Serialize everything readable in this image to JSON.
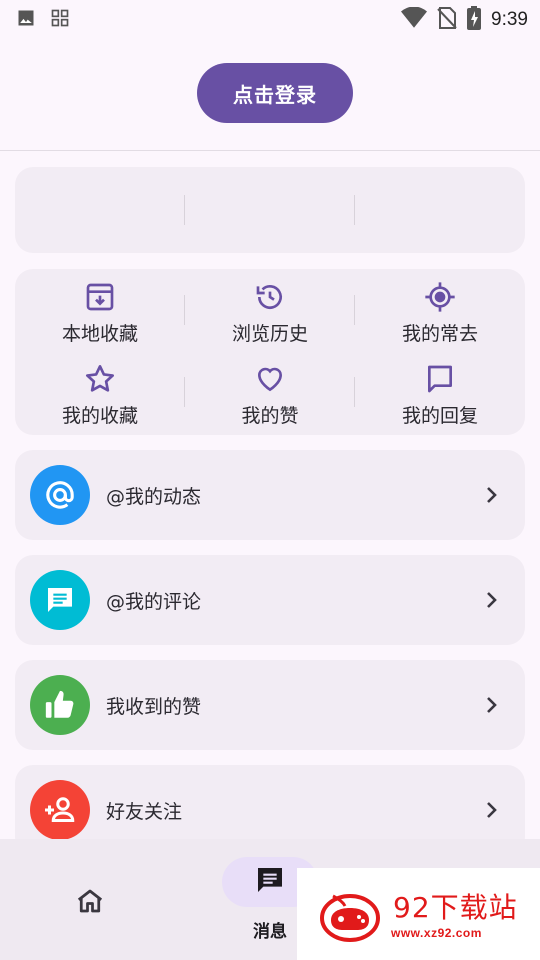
{
  "status_bar": {
    "time": "9:39",
    "left_icons": [
      "image-icon",
      "apps-icon"
    ],
    "right_icons": [
      "wifi-icon",
      "no-sim-icon",
      "battery-charging-icon"
    ]
  },
  "login": {
    "button_label": "点击登录"
  },
  "quick_grid": {
    "items": [
      {
        "label": "本地收藏",
        "icon": "archive-download-icon"
      },
      {
        "label": "浏览历史",
        "icon": "history-icon"
      },
      {
        "label": "我的常去",
        "icon": "location-target-icon"
      },
      {
        "label": "我的收藏",
        "icon": "star-icon"
      },
      {
        "label": "我的赞",
        "icon": "heart-icon"
      },
      {
        "label": "我的回复",
        "icon": "chat-bubble-icon"
      }
    ]
  },
  "message_rows": [
    {
      "label": "@我的动态",
      "icon": "at-icon",
      "color": "#2196f3"
    },
    {
      "label": "@我的评论",
      "icon": "comment-icon",
      "color": "#00bcd4"
    },
    {
      "label": "我收到的赞",
      "icon": "thumb-up-icon",
      "color": "#4caf50"
    },
    {
      "label": "好友关注",
      "icon": "person-add-icon",
      "color": "#f44336"
    }
  ],
  "bottom_nav": {
    "items": [
      {
        "label": "",
        "icon": "home-icon"
      },
      {
        "label": "消息",
        "icon": "message-icon",
        "selected": true
      }
    ]
  },
  "watermark": {
    "title": "92下载站",
    "url": "www.xz92.com"
  },
  "colors": {
    "accent": "#6850a4",
    "background": "#fcf6fd",
    "card": "#f2ecf4"
  }
}
